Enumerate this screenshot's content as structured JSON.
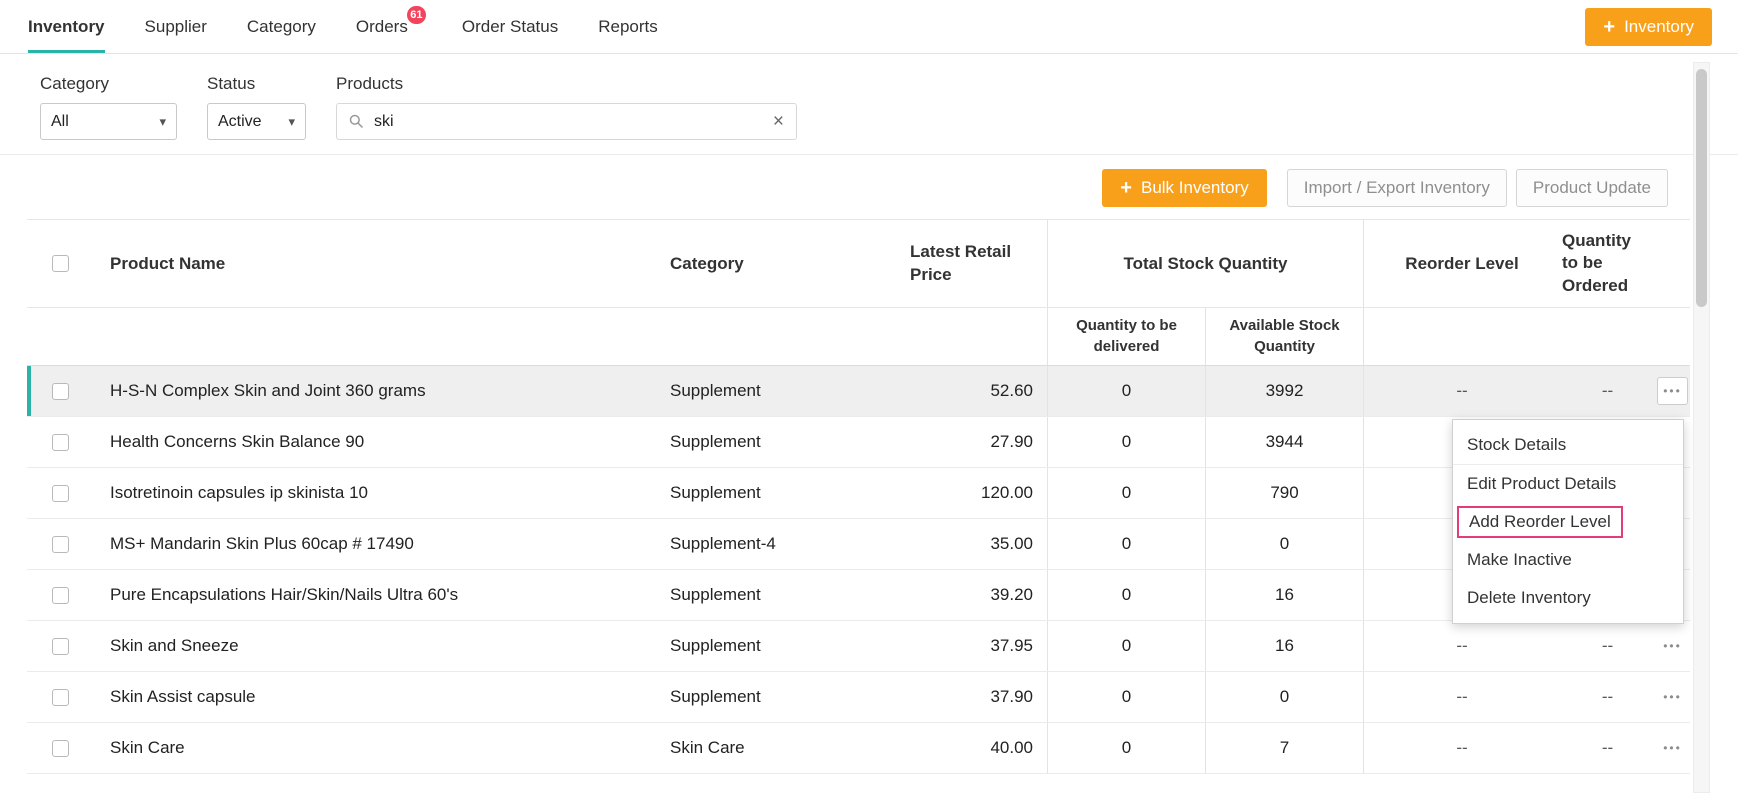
{
  "colors": {
    "accent_orange": "#f9a01b",
    "accent_teal": "#2cb3a9",
    "badge_red": "#f2455d",
    "annotation_pink": "#e23c7a"
  },
  "icons": {
    "ellipsis": "•••",
    "dropdown_arrow": "▾",
    "clear": "×",
    "plus": "+"
  },
  "nav": {
    "tabs": [
      {
        "label": "Inventory"
      },
      {
        "label": "Supplier"
      },
      {
        "label": "Category"
      },
      {
        "label": "Orders",
        "badge": "61"
      },
      {
        "label": "Order Status"
      },
      {
        "label": "Reports"
      }
    ],
    "add_inventory": {
      "label": "Inventory"
    }
  },
  "filters": {
    "category": {
      "label": "Category",
      "value": "All"
    },
    "status": {
      "label": "Status",
      "value": "Active"
    },
    "products": {
      "label": "Products",
      "value": "ski"
    }
  },
  "toolbar": {
    "bulk_inventory": "Bulk Inventory",
    "import_export": "Import / Export Inventory",
    "product_update": "Product Update"
  },
  "table": {
    "headers": {
      "product_name": "Product Name",
      "category": "Category",
      "latest_retail_price": "Latest Retail Price",
      "total_stock_quantity": "Total Stock Quantity",
      "reorder_level": "Reorder Level",
      "quantity_to_be_ordered": "Quantity to be Ordered",
      "sub_quantity_delivered": "Quantity to be delivered",
      "sub_available_stock": "Available Stock Quantity"
    },
    "rows": [
      {
        "product_name": "H-S-N Complex Skin and Joint 360 grams",
        "category": "Supplement",
        "price": "52.60",
        "qty_delivered": "0",
        "available": "3992",
        "reorder": "--",
        "qty_ordered": "--"
      },
      {
        "product_name": "Health Concerns Skin Balance 90",
        "category": "Supplement",
        "price": "27.90",
        "qty_delivered": "0",
        "available": "3944",
        "reorder": "--",
        "qty_ordered": "--"
      },
      {
        "product_name": "Isotretinoin capsules ip skinista 10",
        "category": "Supplement",
        "price": "120.00",
        "qty_delivered": "0",
        "available": "790",
        "reorder": "--",
        "qty_ordered": "--"
      },
      {
        "product_name": "MS+ Mandarin Skin Plus 60cap # 17490",
        "category": "Supplement-4",
        "price": "35.00",
        "qty_delivered": "0",
        "available": "0",
        "reorder": "--",
        "qty_ordered": "--"
      },
      {
        "product_name": "Pure Encapsulations Hair/Skin/Nails Ultra 60's",
        "category": "Supplement",
        "price": "39.20",
        "qty_delivered": "0",
        "available": "16",
        "reorder": "--",
        "qty_ordered": "--"
      },
      {
        "product_name": "Skin and Sneeze",
        "category": "Supplement",
        "price": "37.95",
        "qty_delivered": "0",
        "available": "16",
        "reorder": "--",
        "qty_ordered": "--"
      },
      {
        "product_name": "Skin Assist capsule",
        "category": "Supplement",
        "price": "37.90",
        "qty_delivered": "0",
        "available": "0",
        "reorder": "--",
        "qty_ordered": "--"
      },
      {
        "product_name": "Skin Care",
        "category": "Skin Care",
        "price": "40.00",
        "qty_delivered": "0",
        "available": "7",
        "reorder": "--",
        "qty_ordered": "--"
      }
    ]
  },
  "context_menu": {
    "items": [
      {
        "label": "Stock Details"
      },
      {
        "label": "Edit Product Details"
      },
      {
        "label": "Add Reorder Level"
      },
      {
        "label": "Make Inactive"
      },
      {
        "label": "Delete Inventory"
      }
    ]
  }
}
